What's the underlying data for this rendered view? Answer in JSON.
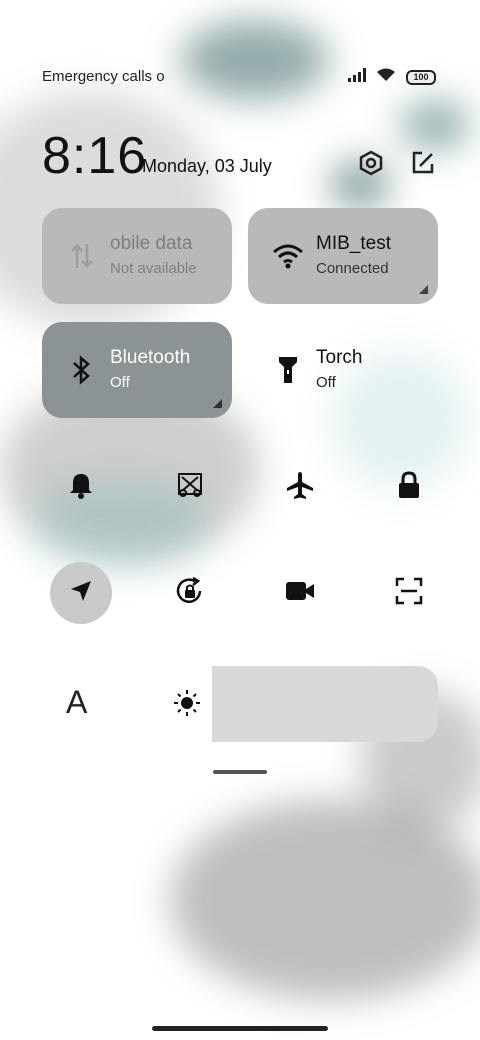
{
  "status_bar": {
    "left_text": "Emergency calls o",
    "battery": "100"
  },
  "clock": {
    "time": "8:16",
    "date": "Monday, 03 July"
  },
  "tiles": {
    "mobile_data": {
      "label": "obile data",
      "sub": "Not available"
    },
    "wifi": {
      "label": "MIB_test",
      "sub": "Connected"
    },
    "bluetooth": {
      "label": "Bluetooth",
      "sub": "Off"
    },
    "torch": {
      "label": "Torch",
      "sub": "Off"
    }
  },
  "icons": {
    "top": [
      "settings-icon",
      "edit-icon"
    ],
    "row1": [
      "bell-icon",
      "screenshot-icon",
      "airplane-icon",
      "lock-icon"
    ],
    "row2": [
      "location-icon",
      "rotation-lock-icon",
      "video-icon",
      "scan-icon"
    ]
  },
  "brightness": {
    "font_label": "A",
    "level": 0.3
  },
  "colors": {
    "tile_active": "#8f9697",
    "tile_inactive": "#b7b9ba",
    "accent_teal": "#2a8c8c"
  }
}
